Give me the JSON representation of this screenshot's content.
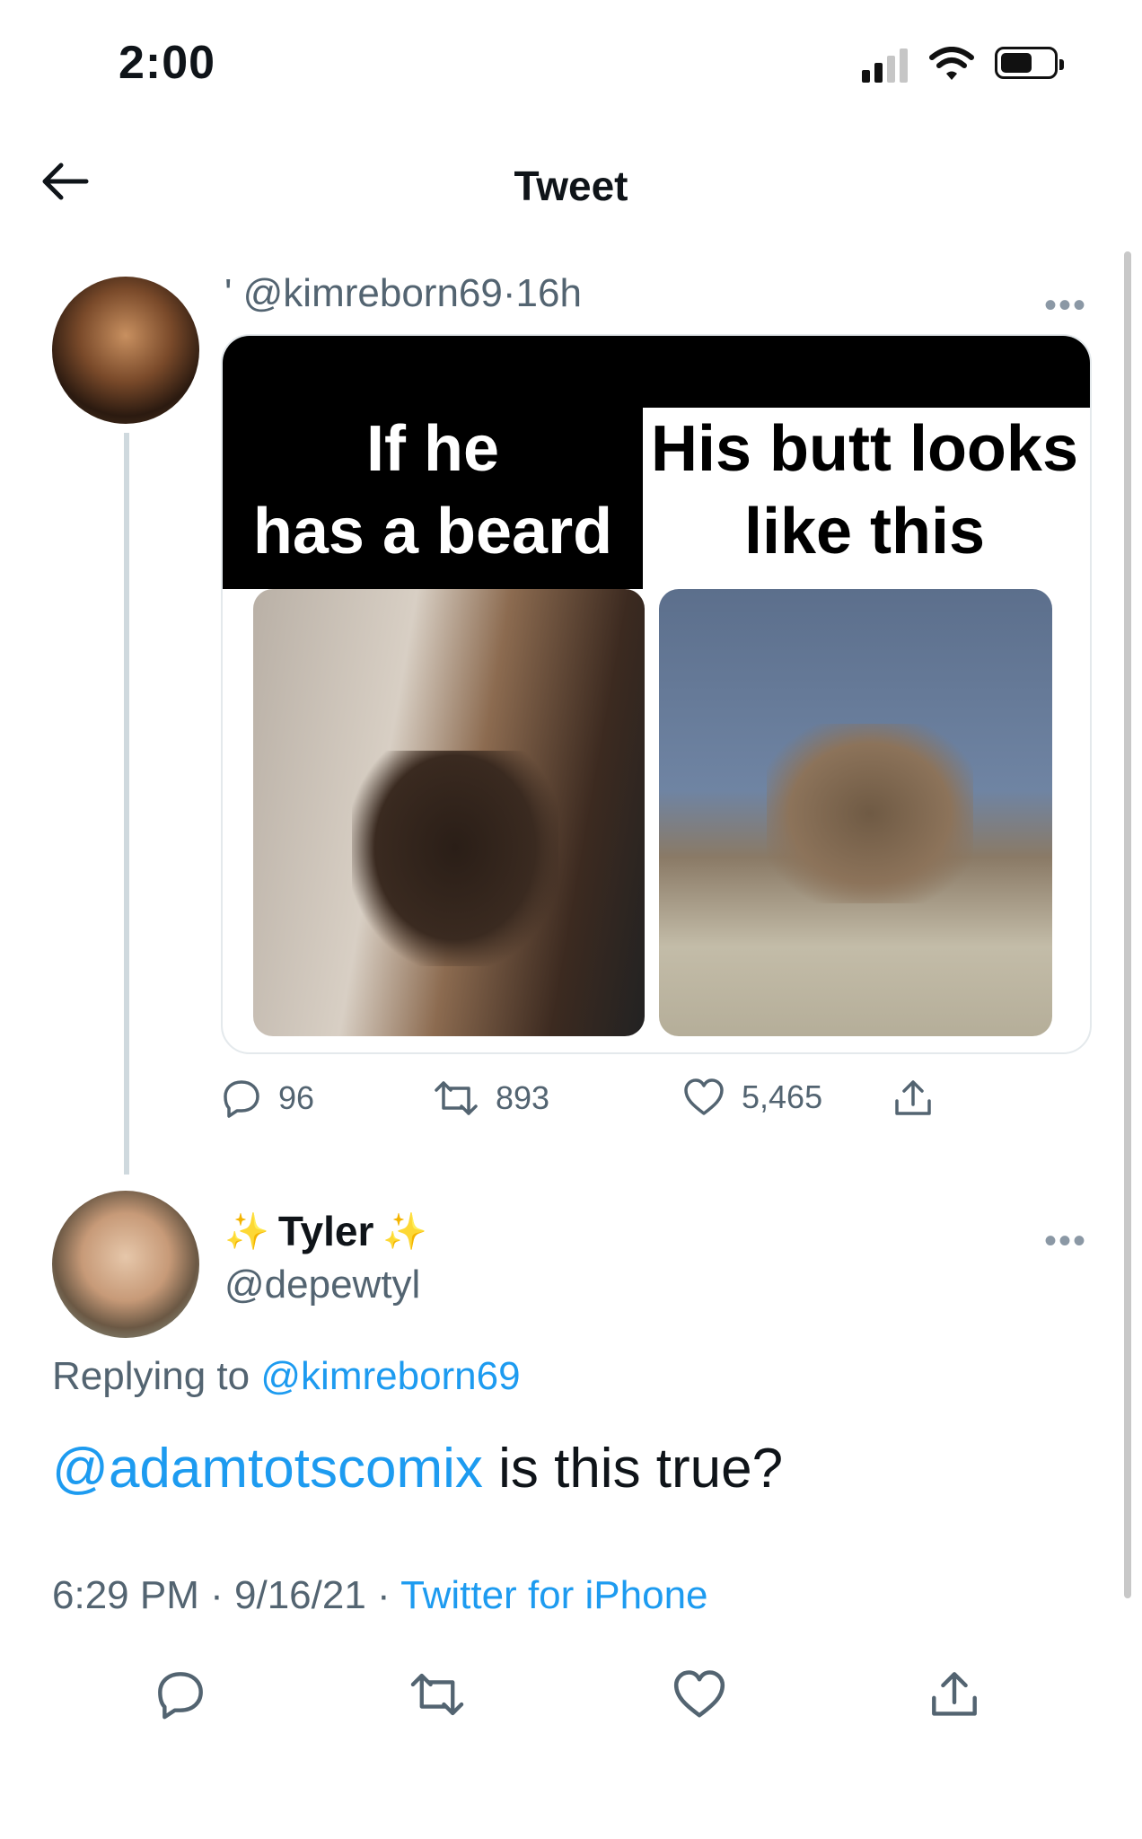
{
  "status_bar": {
    "time": "2:00"
  },
  "header": {
    "title": "Tweet"
  },
  "tweet1": {
    "prefix": "'",
    "handle": "@kimreborn69",
    "separator": "·",
    "age": "16h",
    "media": {
      "left_caption_line1": "If he",
      "left_caption_line2": "has a beard",
      "right_caption_line1": "His butt looks",
      "right_caption_line2": "like this"
    },
    "replies": "96",
    "retweets": "893",
    "likes": "5,465"
  },
  "tweet2": {
    "name": "Tyler",
    "handle": "@depewtyl",
    "replying_prefix": "Replying to",
    "replying_handle": "@kimreborn69",
    "mention": "@adamtotscomix",
    "text": " is this true?",
    "time": "6:29 PM",
    "date": "9/16/21",
    "separator": "·",
    "source": "Twitter for iPhone"
  },
  "icons": [
    "back-arrow-icon",
    "more-icon",
    "reply-icon",
    "retweet-icon",
    "like-icon",
    "share-icon",
    "sparkle-icon"
  ]
}
